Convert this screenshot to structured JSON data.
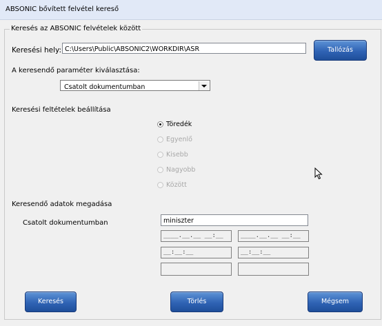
{
  "window": {
    "title": "ABSONIC bővített felvétel kereső"
  },
  "search_group": {
    "legend": "Keresés az ABSONIC felvételek között"
  },
  "path": {
    "label": "Keresési hely:",
    "value": "C:\\Users\\Public\\ABSONIC2\\WORKDIR\\ASR",
    "browse_label": "Tallózás"
  },
  "param": {
    "label": "A keresendő paraméter kiválasztása:",
    "selected": "Csatolt dokumentumban"
  },
  "conditions": {
    "label": "Keresési feltételek beállítása",
    "options": [
      {
        "label": "Töredék",
        "checked": true,
        "enabled": true
      },
      {
        "label": "Egyenlő",
        "checked": false,
        "enabled": false
      },
      {
        "label": "Kisebb",
        "checked": false,
        "enabled": false
      },
      {
        "label": "Nagyobb",
        "checked": false,
        "enabled": false
      },
      {
        "label": "Között",
        "checked": false,
        "enabled": false
      }
    ]
  },
  "data_entry": {
    "label": "Keresendő adatok megadása",
    "field_label": "Csatolt dokumentumban",
    "field_value": "miniszter",
    "date_mask_1": "____.__.__ __:__",
    "date_mask_2": "____.__.__ __:__",
    "time_mask_1": "__:__:__",
    "time_mask_2": "__:__:__",
    "extra_1": "",
    "extra_2": ""
  },
  "buttons": {
    "search": "Keresés",
    "clear": "Törlés",
    "cancel": "Mégsem"
  },
  "colors": {
    "button_blue": "#2f63b4",
    "titlebar": "#e1e9f7"
  }
}
